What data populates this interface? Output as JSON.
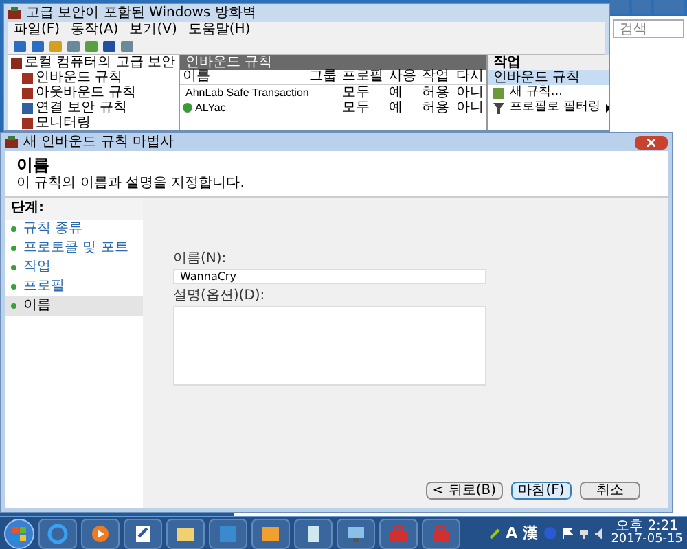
{
  "background_window": {
    "search": {
      "placeholder": "검색"
    }
  },
  "firewall_window": {
    "title": "고급 보안이 포함된 Windows 방화벽",
    "menu": [
      "파일(F)",
      "동작(A)",
      "보기(V)",
      "도움말(H)"
    ],
    "tree": {
      "label": "로컬 컴퓨터의 고급 보안",
      "children": [
        {
          "label": "인바운드 규칙"
        },
        {
          "label": "아웃바운드 규칙"
        },
        {
          "label": "연결 보안 규칙"
        },
        {
          "label": "모니터링"
        }
      ]
    },
    "panel_title": "인바운드 규칙",
    "columns": [
      "이름",
      "그룹",
      "프로필",
      "사용",
      "작업",
      "다시"
    ],
    "rows": [
      {
        "name": "AhnLab Safe Transaction",
        "profile": "모두",
        "enabled": "예",
        "action": "허용",
        "column_6": "아니"
      },
      {
        "name": "ALYac",
        "profile": "모두",
        "enabled": "예",
        "action": "허용",
        "column_6": "아니"
      }
    ],
    "actions": {
      "title": "작업",
      "section": "인바운드 규칙",
      "items": [
        {
          "label": "새 규칙...",
          "kind": "link"
        },
        {
          "label": "프로필로 필터링",
          "kind": "submenu"
        }
      ]
    }
  },
  "wizard": {
    "title": "새 인바운드 규칙 마법사",
    "heading": "이름",
    "subtitle": "이 규칙의 이름과 설명을 지정합니다.",
    "steps_title": "단계:",
    "steps": [
      {
        "label": "규칙 종류",
        "selected": false
      },
      {
        "label": "프로토콜 및 포트",
        "selected": false
      },
      {
        "label": "작업",
        "selected": false
      },
      {
        "label": "프로필",
        "selected": false
      },
      {
        "label": "이름",
        "selected": true
      }
    ],
    "name_field": {
      "label": "이름(N):",
      "value": "WannaCry"
    },
    "description_field": {
      "label": "설명(옵션)(D):"
    },
    "buttons": [
      {
        "label": "< 뒤로(B)",
        "default": false
      },
      {
        "label": "마침(F)",
        "default": true
      },
      {
        "label": "취소",
        "default": false
      }
    ]
  },
  "taskbar": {
    "tray": [
      "A",
      "漢"
    ],
    "time": "오후 2:21",
    "date": "2017-05-15"
  }
}
